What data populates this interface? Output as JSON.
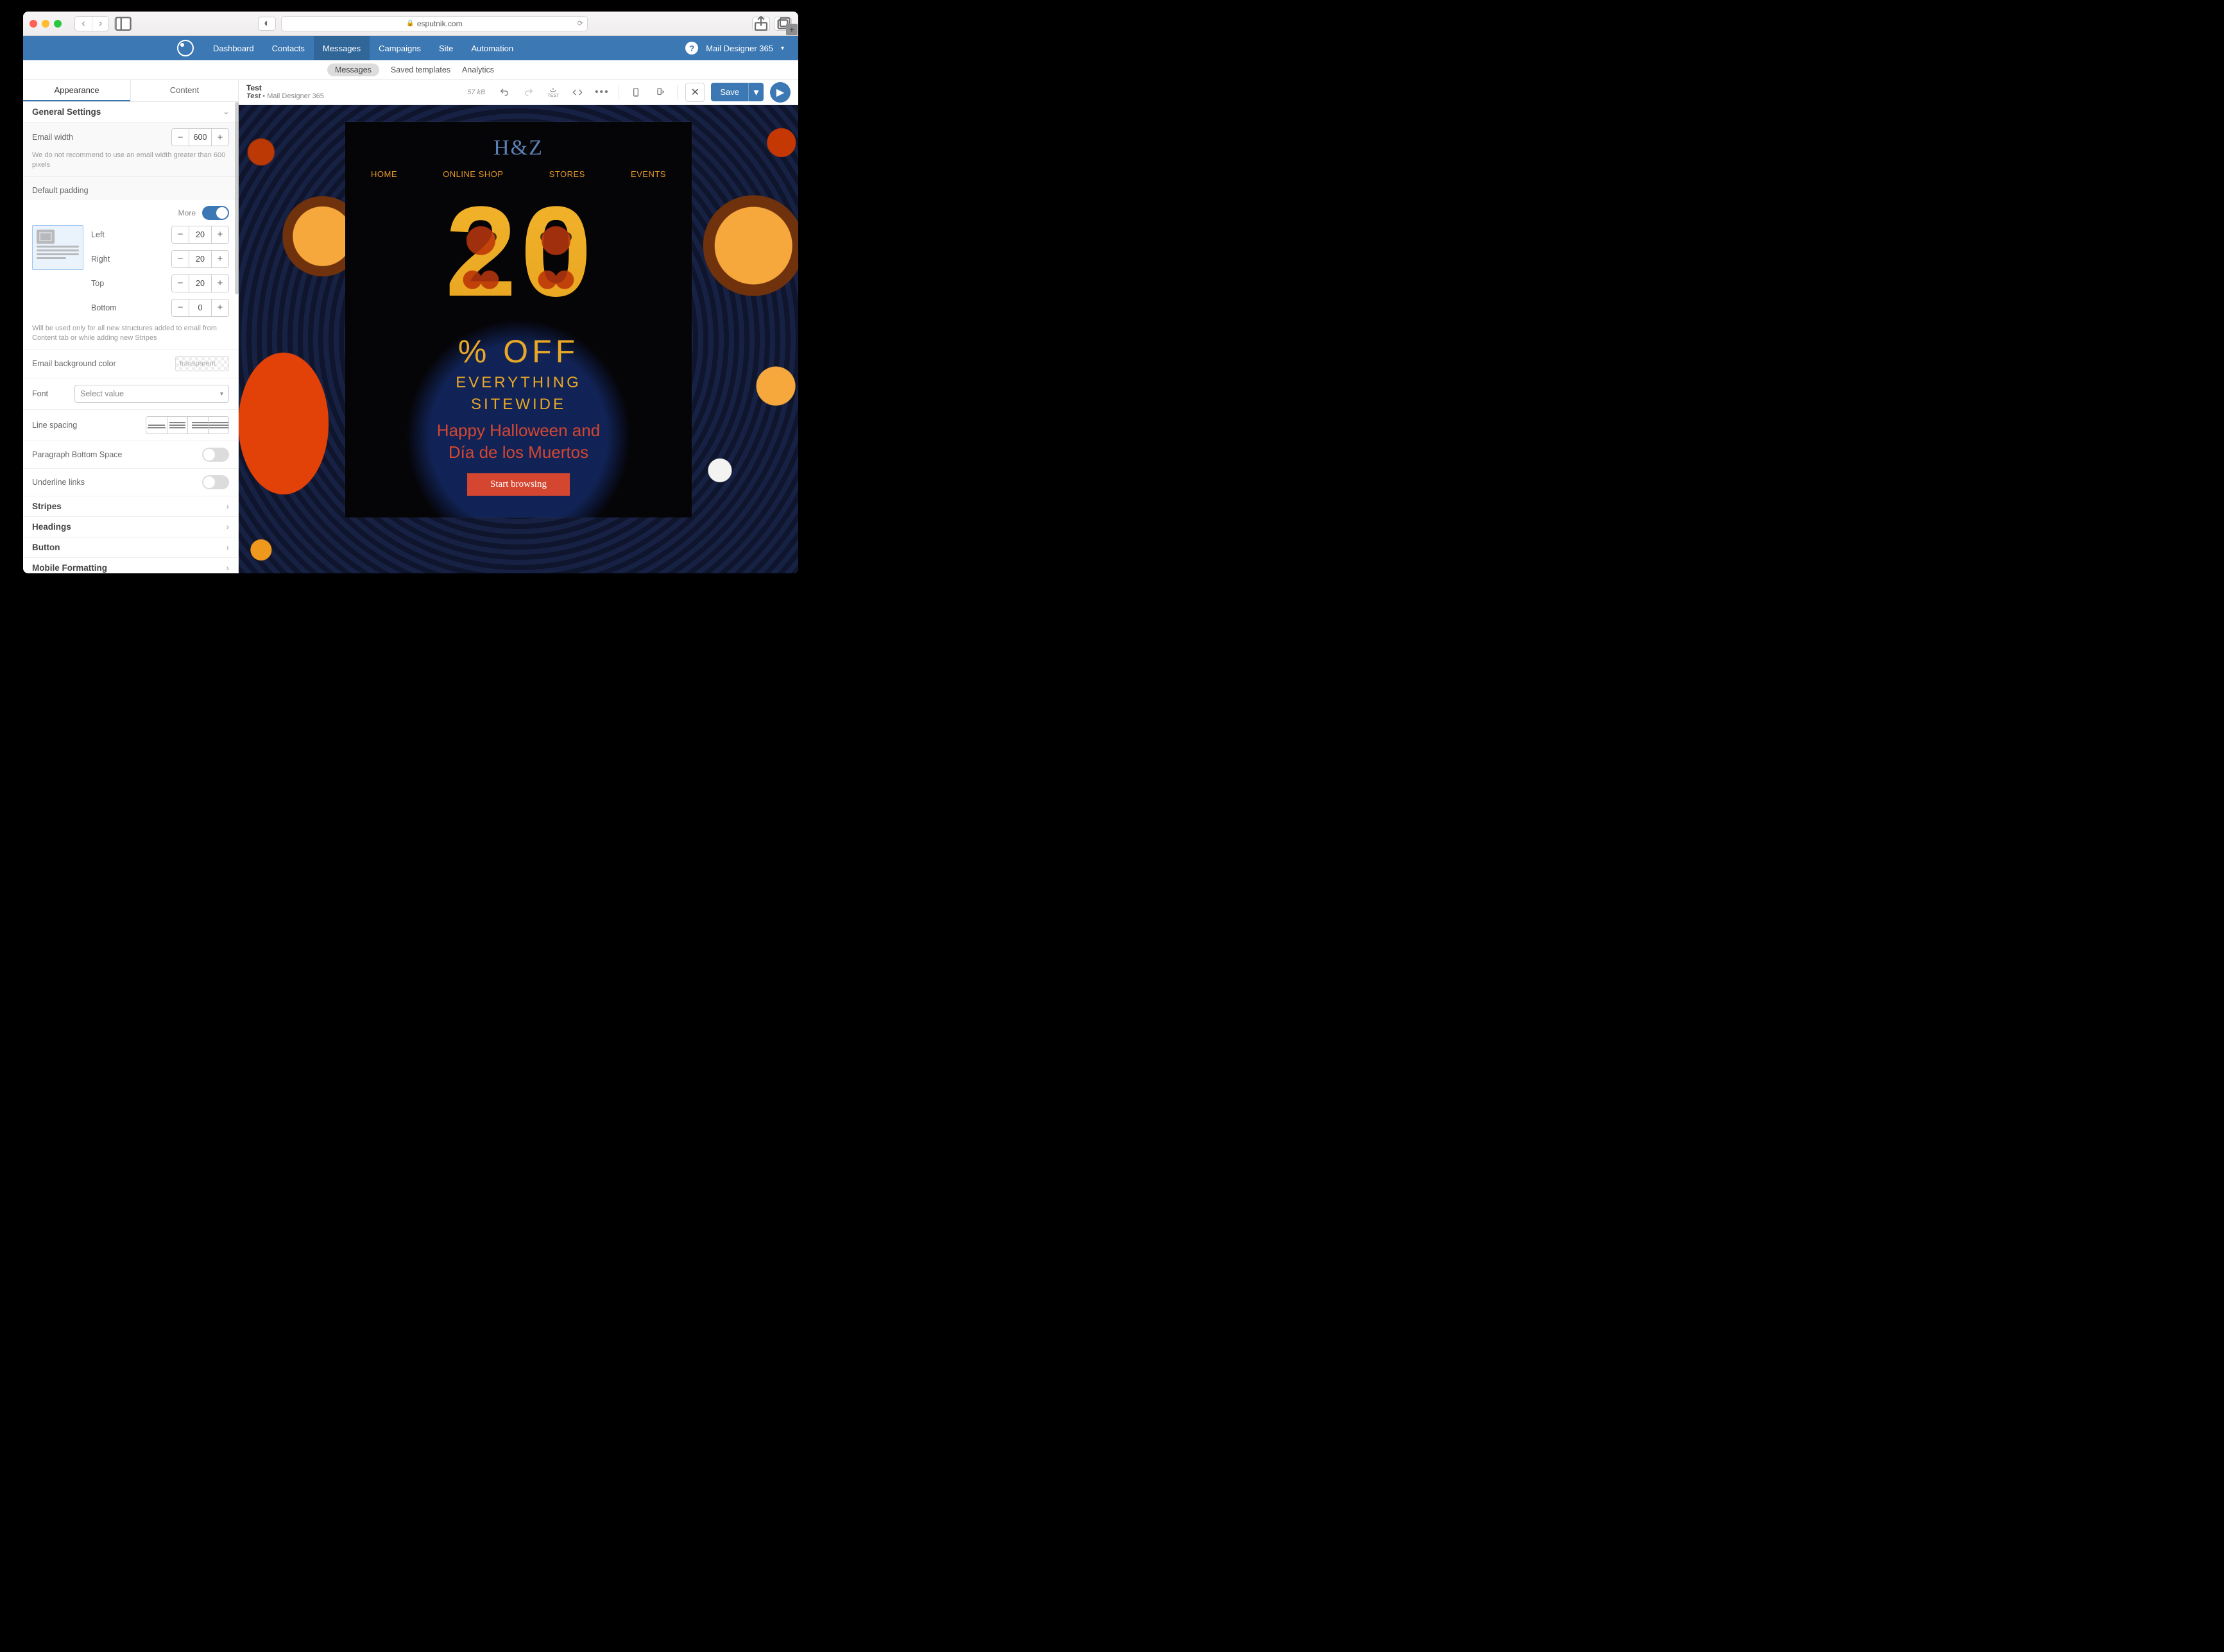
{
  "browser": {
    "url_host": "esputnik.com"
  },
  "nav": {
    "tabs": [
      "Dashboard",
      "Contacts",
      "Messages",
      "Campaigns",
      "Site",
      "Automation"
    ],
    "active_index": 2,
    "account": "Mail Designer 365"
  },
  "subnav": {
    "items": [
      "Messages",
      "Saved templates",
      "Analytics"
    ],
    "active_index": 0
  },
  "side_tabs": {
    "items": [
      "Appearance",
      "Content"
    ],
    "active_index": 0
  },
  "general": {
    "title": "General Settings",
    "email_width_label": "Email width",
    "email_width_value": "600",
    "email_width_note": "We do not recommend to use an email width greater than 600 pixels"
  },
  "padding": {
    "section": "Default padding",
    "more": "More",
    "fields": {
      "Left": "20",
      "Right": "20",
      "Top": "20",
      "Bottom": "0"
    },
    "note": "Will be used only for all new structures added to email from Content tab or while adding new Stripes"
  },
  "misc": {
    "bg_label": "Email background color",
    "bg_value": "transparent",
    "font_label": "Font",
    "font_value": "Select value",
    "line_label": "Line spacing",
    "para_label": "Paragraph Bottom Space",
    "under_label": "Underline links"
  },
  "accordions": [
    "Stripes",
    "Headings",
    "Button",
    "Mobile Formatting"
  ],
  "editor": {
    "title": "Test",
    "subtitle_name": "Test",
    "subtitle_sep": " • ",
    "subtitle_account": "Mail Designer 365",
    "size": "57 kB",
    "save": "Save"
  },
  "email": {
    "logo": "H&Z",
    "menu": [
      "HOME",
      "ONLINE SHOP",
      "STORES",
      "EVENTS"
    ],
    "pct": "% OFF",
    "sub1": "EVERYTHING",
    "sub2": "SITEWIDE",
    "hallo1": "Happy Halloween and",
    "hallo2": "Día de los Muertos",
    "cta": "Start browsing"
  }
}
